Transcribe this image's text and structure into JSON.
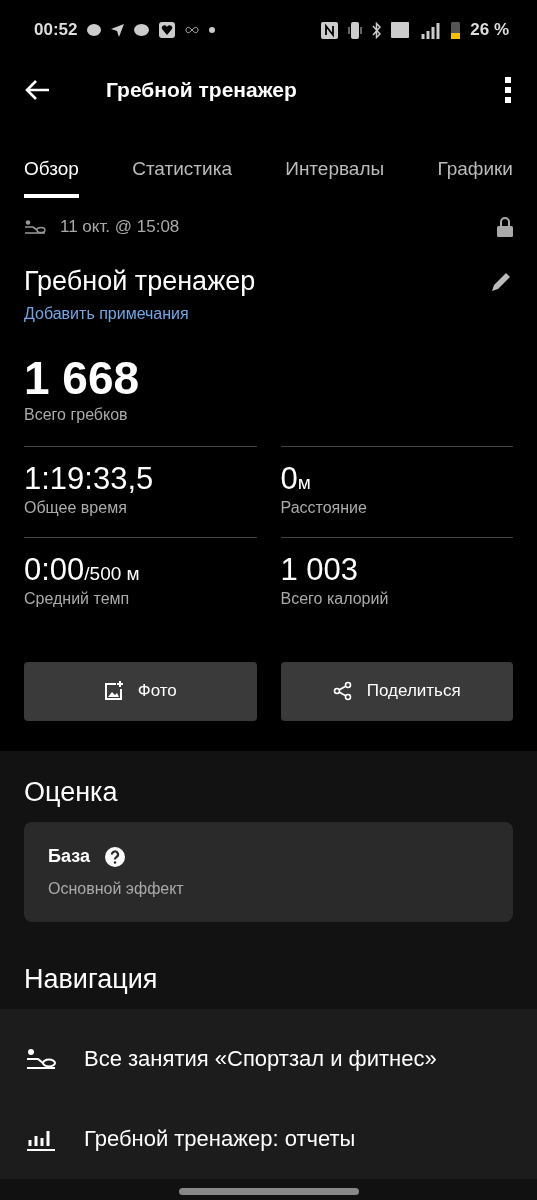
{
  "status_bar": {
    "time": "00:52",
    "battery": "26 %"
  },
  "app_bar": {
    "title": "Гребной тренажер"
  },
  "tabs": [
    {
      "label": "Обзор",
      "selected": true
    },
    {
      "label": "Статистика",
      "selected": false
    },
    {
      "label": "Интервалы",
      "selected": false
    },
    {
      "label": "Графики",
      "selected": false
    }
  ],
  "activity": {
    "date": "11 окт. @ 15:08",
    "title": "Гребной тренажер",
    "notes_link": "Добавить примечания",
    "total": {
      "value": "1 668",
      "label": "Всего гребков"
    }
  },
  "stats": [
    {
      "value": "1:19:33,5",
      "label": "Общее время"
    },
    {
      "value": "0",
      "unit": "м",
      "label": "Расстояние"
    },
    {
      "value": "0:00",
      "unit": "/500 м",
      "label": "Средний темп"
    },
    {
      "value": "1 003",
      "label": "Всего калорий"
    }
  ],
  "buttons": [
    {
      "kind": "photo",
      "label": "Фото"
    },
    {
      "kind": "share",
      "label": "Поделиться"
    }
  ],
  "rating": {
    "heading": "Оценка",
    "title": "База",
    "subtitle": "Основной эффект"
  },
  "navigation": {
    "heading": "Навигация",
    "items": [
      {
        "kind": "activities",
        "label": "Все занятия «Спортзал и фитнес»"
      },
      {
        "kind": "reports",
        "label": "Гребной тренажер: отчеты"
      }
    ]
  }
}
